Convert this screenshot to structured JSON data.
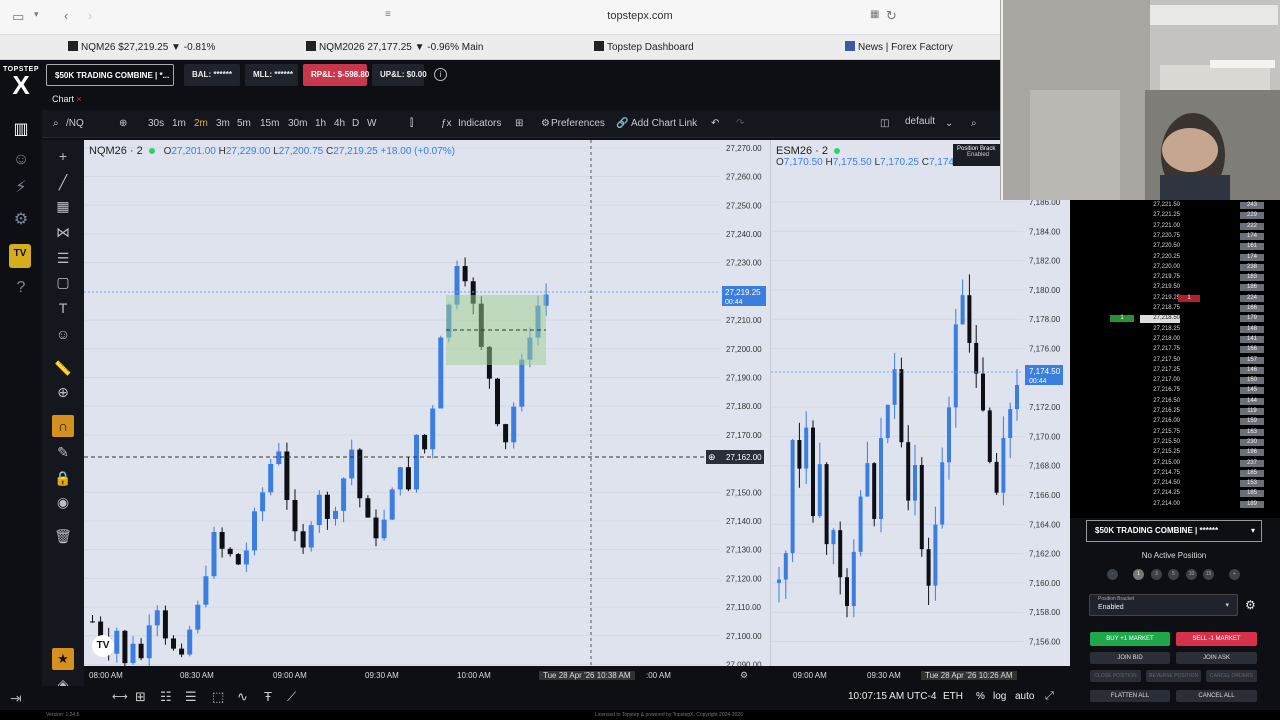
{
  "browser": {
    "url": "topstepx.com",
    "tabs": [
      {
        "label": "NQM26 $27,219.25 ▼ -0.81%"
      },
      {
        "label": "NQM2026 27,177.25 ▼ -0.96% Main"
      },
      {
        "label": "Topstep Dashboard"
      },
      {
        "label": "News | Forex Factory"
      }
    ]
  },
  "app": {
    "logo_top": "TOPSTEP",
    "logo_mark": "X",
    "account_label": "$50K TRADING COMBINE | *...",
    "bal": "BAL: ******",
    "mll": "MLL: ******",
    "rpl": "RP&L: $-598.80",
    "upl": "UP&L: $0.00",
    "info": "i",
    "live_badge": "TV"
  },
  "chart_tab": "Chart",
  "toolbar": {
    "symbol": "/NQ",
    "timeframes": [
      "30s",
      "1m",
      "2m",
      "3m",
      "5m",
      "15m",
      "30m",
      "1h",
      "4h",
      "D",
      "W"
    ],
    "active_timeframe": "2m",
    "indicators": "Indicators",
    "preferences": "Preferences",
    "chart_link": "Add Chart Link",
    "layout": "default"
  },
  "charts": [
    {
      "symbol": "NQM26 · 2",
      "O": "27,201.00",
      "H": "27,229.00",
      "L": "27,200.75",
      "C": "27,219.25",
      "change": "+18.00 (+0.07%)",
      "price_labels": [
        "27,270.00",
        "27,260.00",
        "27,250.00",
        "27,240.00",
        "27,230.00",
        "27,210.00",
        "27,200.00",
        "27,190.00",
        "27,180.00",
        "27,170.00",
        "27,150.00",
        "27,140.00",
        "27,130.00",
        "27,120.00",
        "27,110.00",
        "27,100.00",
        "27,090.00"
      ],
      "last_price": "27,219.25",
      "last_timer": "00:44",
      "crosshair_price": "27,162.00"
    },
    {
      "symbol": "ESM26 · 2",
      "O": "7,170.50",
      "H": "7,175.50",
      "L": "7,170.25",
      "C": "7,174",
      "price_labels": [
        "7,186.00",
        "7,184.00",
        "7,182.00",
        "7,180.00",
        "7,178.00",
        "7,176.00",
        "7,172.00",
        "7,170.00",
        "7,168.00",
        "7,166.00",
        "7,164.00",
        "7,162.00",
        "7,160.00",
        "7,158.00",
        "7,156.00"
      ],
      "last_price": "7,174.50",
      "last_timer": "00:44",
      "bracket_title": "Position Brack",
      "bracket_status": "Enabled"
    }
  ],
  "time_axis": {
    "chart1": [
      "08:00 AM",
      "08:30 AM",
      "09:00 AM",
      "09:30 AM",
      "10:00 AM"
    ],
    "crosshair_time": "Tue 28 Apr '26   10:38 AM",
    "chart1_after": ":00 AM",
    "chart2": [
      "09:00 AM",
      "09:30 AM"
    ],
    "chart2_crosshair": "Tue 28 Apr '26   10:26 AM"
  },
  "bottom_bar": {
    "clock": "10:07:15 AM UTC-4",
    "session": "ETH",
    "pct": "%",
    "log": "log",
    "auto": "auto"
  },
  "dom": [
    {
      "price": "27,221.50",
      "vol": "243"
    },
    {
      "price": "27,221.25",
      "vol": "229"
    },
    {
      "price": "27,221.00",
      "vol": "222"
    },
    {
      "price": "27,220.75",
      "vol": "174"
    },
    {
      "price": "27,220.50",
      "vol": "161"
    },
    {
      "price": "27,220.25",
      "vol": "174"
    },
    {
      "price": "27,220.00",
      "vol": "238"
    },
    {
      "price": "27,219.75",
      "vol": "183"
    },
    {
      "price": "27,219.50",
      "vol": "186"
    },
    {
      "price": "27,219.25",
      "vol": "224",
      "ask": "1"
    },
    {
      "price": "27,218.75",
      "vol": "166"
    },
    {
      "price": "27,218.50",
      "vol": "179",
      "bid": "1",
      "current": true
    },
    {
      "price": "27,218.25",
      "vol": "148"
    },
    {
      "price": "27,218.00",
      "vol": "141"
    },
    {
      "price": "27,217.75",
      "vol": "166"
    },
    {
      "price": "27,217.50",
      "vol": "157"
    },
    {
      "price": "27,217.25",
      "vol": "146"
    },
    {
      "price": "27,217.00",
      "vol": "150"
    },
    {
      "price": "27,216.75",
      "vol": "145"
    },
    {
      "price": "27,216.50",
      "vol": "144"
    },
    {
      "price": "27,216.25",
      "vol": "119"
    },
    {
      "price": "27,216.00",
      "vol": "159"
    },
    {
      "price": "27,215.75",
      "vol": "163"
    },
    {
      "price": "27,215.50",
      "vol": "230"
    },
    {
      "price": "27,215.25",
      "vol": "196"
    },
    {
      "price": "27,215.00",
      "vol": "237"
    },
    {
      "price": "27,214.75",
      "vol": "185"
    },
    {
      "price": "27,214.50",
      "vol": "153"
    },
    {
      "price": "27,214.25",
      "vol": "185"
    },
    {
      "price": "27,214.00",
      "vol": "189"
    }
  ],
  "order_panel": {
    "account": "$50K TRADING COMBINE | ******",
    "position": "No Active Position",
    "qty": [
      "-",
      "1",
      "3",
      "5",
      "10",
      "15",
      "+"
    ],
    "bracket_caption": "Position Bracket",
    "bracket_value": "Enabled",
    "buy": "BUY +1 MARKET",
    "sell": "SELL -1 MARKET",
    "join_bid": "JOIN BID",
    "join_ask": "JOIN ASK",
    "close_pos": "CLOSE POSITION",
    "reverse_pos": "REVERSE POSITION",
    "cancel_orders": "CANCEL ORDERS",
    "flatten": "FLATTEN ALL",
    "cancel_all": "CANCEL ALL"
  },
  "footer": {
    "version": "Version: 1.24.5",
    "license": "Licensed to Topstep & powered by TopstepX. Copyright 2024-2026"
  }
}
